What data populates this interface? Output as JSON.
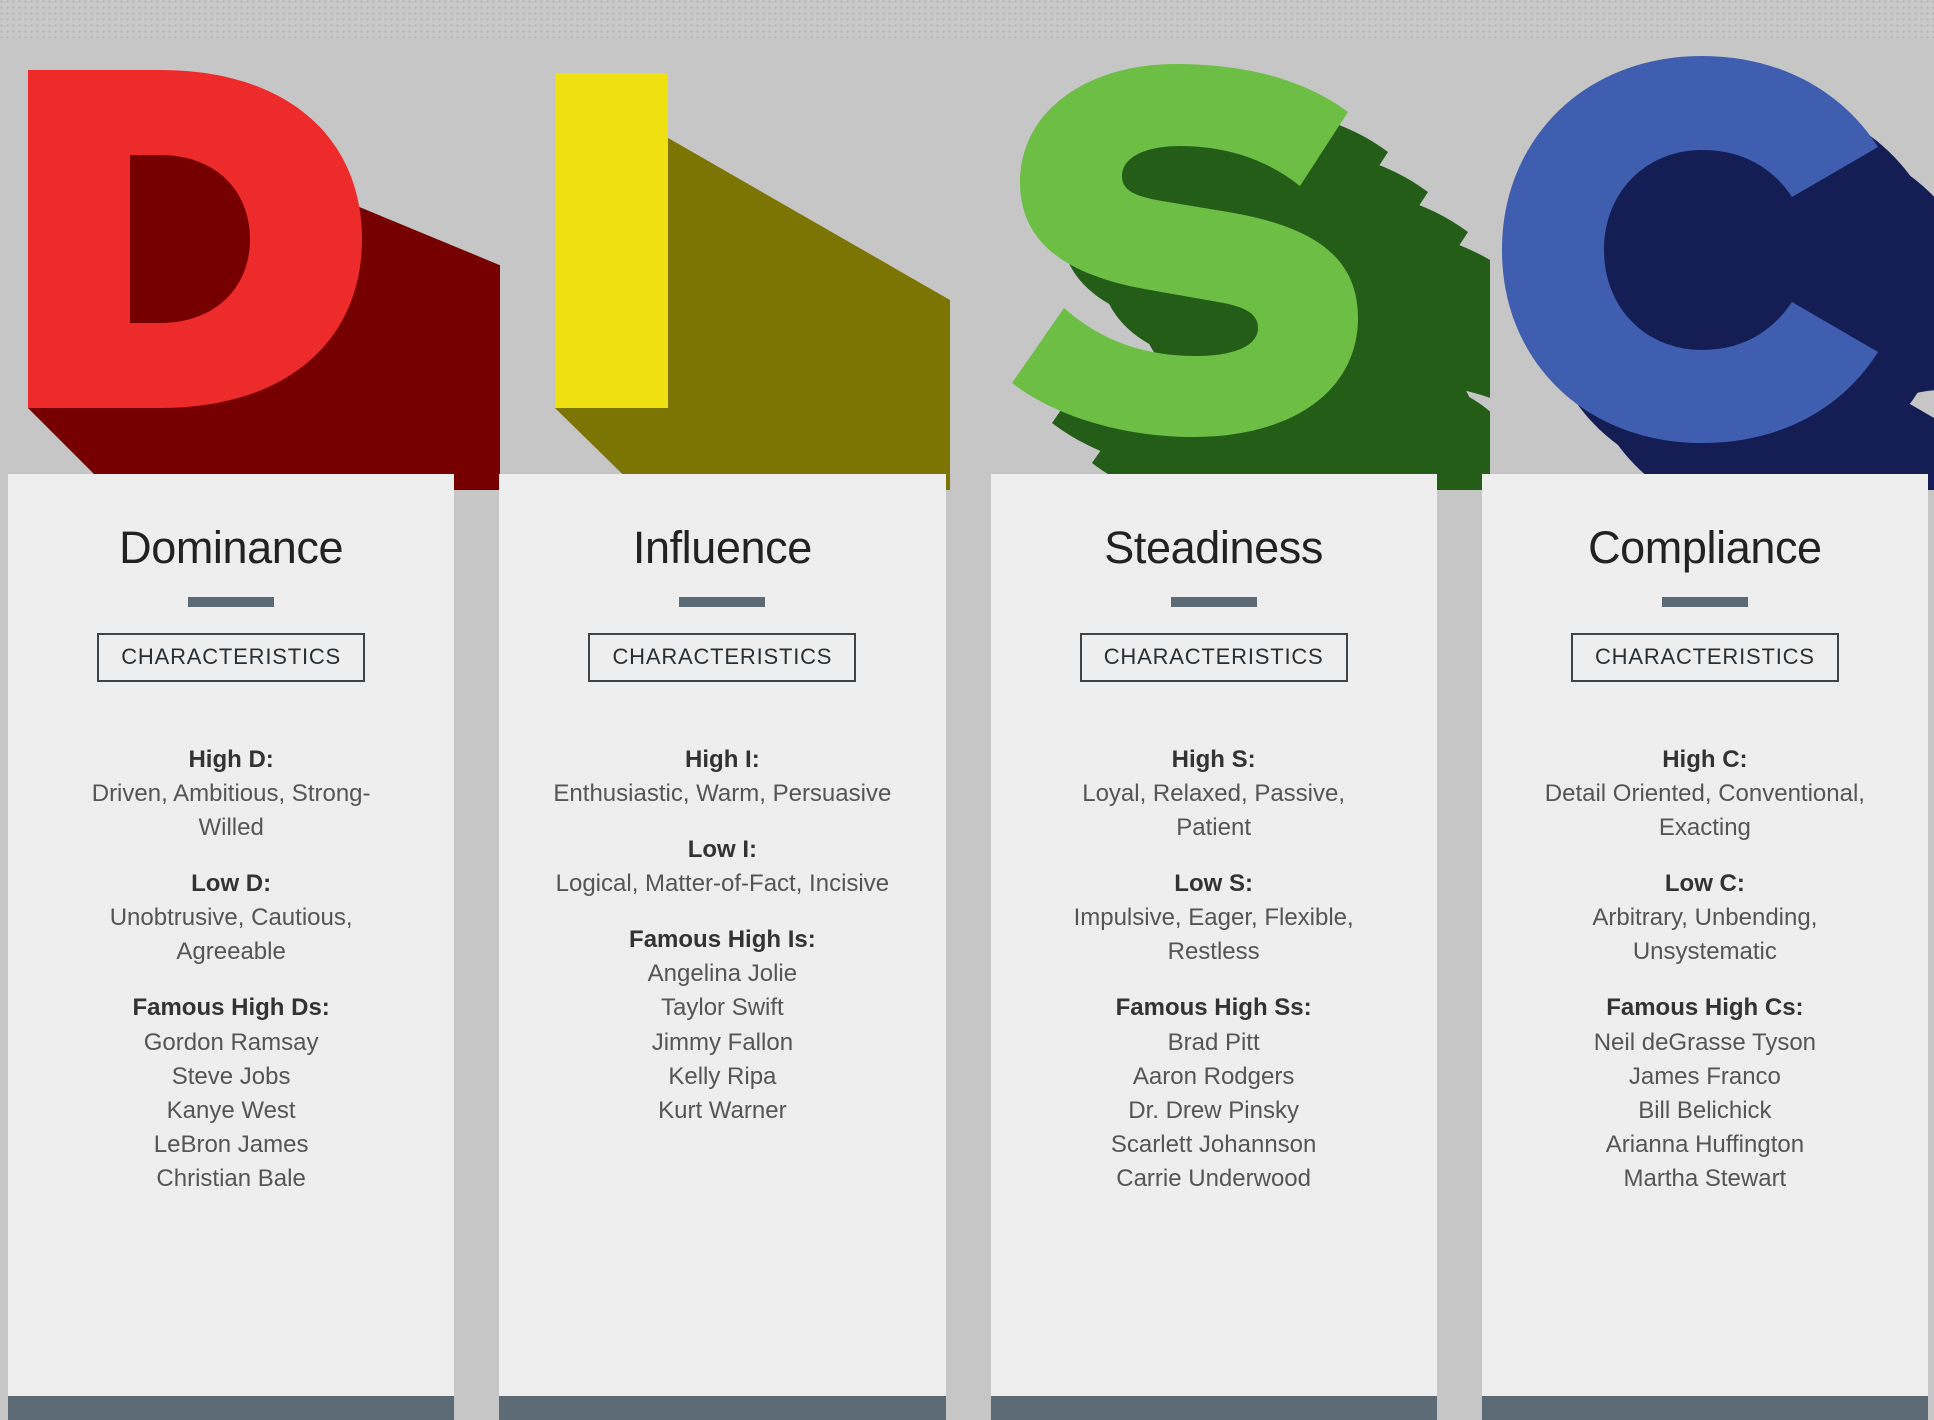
{
  "palette": {
    "page_background": "#c6c6c6",
    "card_background": "#eeeeee",
    "accent_rule": "#5d6b77",
    "heading_text": "#222222",
    "body_text": "#555555"
  },
  "letters": [
    {
      "glyph": "D",
      "name": "letter-d",
      "face_color": "#ee2b2b",
      "shadow_color": "#760000"
    },
    {
      "glyph": "I",
      "name": "letter-i",
      "face_color": "#efe111",
      "shadow_color": "#7d7503"
    },
    {
      "glyph": "S",
      "name": "letter-s",
      "face_color": "#6cbe45",
      "shadow_color": "#245d18"
    },
    {
      "glyph": "C",
      "name": "letter-c",
      "face_color": "#3f5eb0",
      "shadow_color": "#141e55"
    }
  ],
  "cards": [
    {
      "title": "Dominance",
      "button_label": "CHARACTERISTICS",
      "high_label": "High D:",
      "high_value": "Driven, Ambitious, Strong-Willed",
      "low_label": "Low D:",
      "low_value": "Unobtrusive, Cautious, Agreeable",
      "famous_label": "Famous High Ds:",
      "famous": [
        "Gordon Ramsay",
        "Steve Jobs",
        "Kanye West",
        "LeBron James",
        "Christian Bale"
      ]
    },
    {
      "title": "Influence",
      "button_label": "CHARACTERISTICS",
      "high_label": "High I:",
      "high_value": "Enthusiastic, Warm, Persuasive",
      "low_label": "Low I:",
      "low_value": "Logical, Matter-of-Fact, Incisive",
      "famous_label": "Famous High Is:",
      "famous": [
        "Angelina Jolie",
        "Taylor Swift",
        "Jimmy Fallon",
        "Kelly Ripa",
        "Kurt Warner"
      ]
    },
    {
      "title": "Steadiness",
      "button_label": "CHARACTERISTICS",
      "high_label": "High S:",
      "high_value": "Loyal, Relaxed, Passive, Patient",
      "low_label": "Low S:",
      "low_value": "Impulsive, Eager, Flexible, Restless",
      "famous_label": "Famous High Ss:",
      "famous": [
        "Brad Pitt",
        "Aaron Rodgers",
        "Dr. Drew Pinsky",
        "Scarlett Johannson",
        "Carrie Underwood"
      ]
    },
    {
      "title": "Compliance",
      "button_label": "CHARACTERISTICS",
      "high_label": "High C:",
      "high_value": "Detail Oriented, Conventional, Exacting",
      "low_label": "Low C:",
      "low_value": "Arbitrary, Unbending, Unsystematic",
      "famous_label": "Famous High Cs:",
      "famous": [
        "Neil deGrasse Tyson",
        "James Franco",
        "Bill Belichick",
        "Arianna Huffington",
        "Martha Stewart"
      ]
    }
  ]
}
